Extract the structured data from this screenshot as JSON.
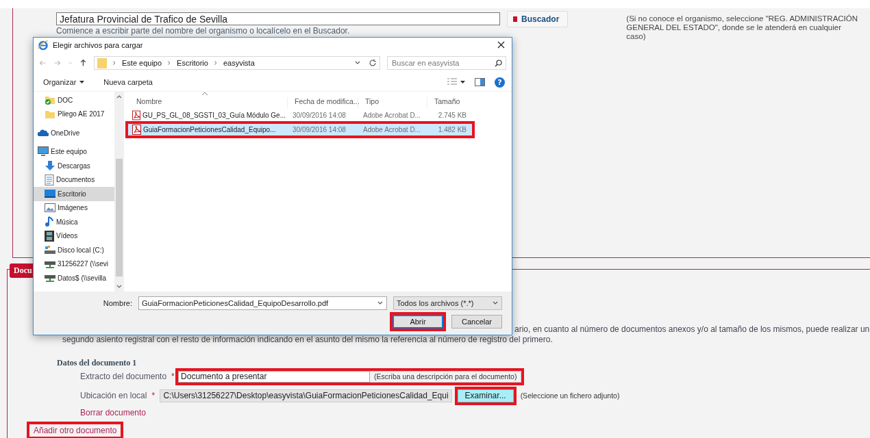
{
  "organism": {
    "value": "Jefatura Provincial de Trafico de Sevilla",
    "hint": "Comience a escribir parte del nombre del organismo o localícelo en el Buscador.",
    "button": "Buscador",
    "note": "(Si no conoce el organismo, seleccione \"REG. ADMINISTRACIÓN GENERAL DEL ESTADO\", donde se le atenderá en cualquier caso)"
  },
  "documents": {
    "legend": "Docu",
    "notice_line_1": "ario, en cuanto al número de documentos anexos y/o al tamaño de los mismos, puede realizar un",
    "notice_line_2": "segundo asiento registral con el resto de información indicando en el asunto del mismo la referencia al número de registro del primero.",
    "title": "Datos del documento 1",
    "fields": [
      {
        "kind": "text",
        "label": "Extracto del documento",
        "required_mark": "*",
        "value": "Documento a presentar",
        "hint": "(Escriba una descripción para el documento)",
        "highlighted": true
      },
      {
        "kind": "file",
        "label": "Ubicación en local",
        "required_mark": "*",
        "value": "C:\\Users\\31256227\\Desktop\\easyvista\\GuiaFormacionPeticionesCalidad_Equi",
        "button": {
          "label": "Examinar...",
          "highlighted": true
        },
        "note": "(Seleccione un fichero adjunto)"
      }
    ],
    "delete_link": "Borrar documento",
    "add_link": {
      "label": "Añadir otro documento",
      "highlighted": true
    }
  },
  "dialog": {
    "title": "Elegir archivos para cargar",
    "breadcrumbs": [
      "Este equipo",
      "Escritorio",
      "easyvista"
    ],
    "search_placeholder": "Buscar en easyvista",
    "organize": "Organizar",
    "new_folder": "Nueva carpeta",
    "help_glyph": "?",
    "quick_access": [
      {
        "label": "DOC",
        "kind": "synced-folder",
        "selected": false
      },
      {
        "label": "Pliego AE 2017",
        "kind": "folder",
        "selected": false
      }
    ],
    "tree": [
      {
        "label": "OneDrive",
        "kind": "cloud",
        "selected": false
      },
      {
        "label": "Este equipo",
        "kind": "computer",
        "selected": false,
        "children": [
          {
            "label": "Descargas",
            "kind": "download",
            "selected": false
          },
          {
            "label": "Documentos",
            "kind": "document",
            "selected": false
          },
          {
            "label": "Escritorio",
            "kind": "desktop",
            "selected": true
          },
          {
            "label": "Imágenes",
            "kind": "image",
            "selected": false
          },
          {
            "label": "Música",
            "kind": "music",
            "selected": false
          },
          {
            "label": "Vídeos",
            "kind": "video",
            "selected": false
          },
          {
            "label": "Disco local (C:)",
            "kind": "drive",
            "selected": false
          },
          {
            "label": "31256227 (\\\\sevi",
            "kind": "network",
            "selected": false
          },
          {
            "label": "Datos$ (\\\\sevilla",
            "kind": "network",
            "selected": false
          }
        ]
      }
    ],
    "columns": [
      "Nombre",
      "Fecha de modifica...",
      "Tipo",
      "Tamaño"
    ],
    "files": [
      {
        "name": "GU_PS_GL_08_SGSTI_03_Guía Módulo Ge...",
        "date": "30/09/2016 14:08",
        "type": "Adobe Acrobat D...",
        "size": "2.745 KB",
        "selected": false,
        "highlighted": false
      },
      {
        "name": "GuiaFormacionPeticionesCalidad_Equipo...",
        "date": "30/09/2016 14:08",
        "type": "Adobe Acrobat D...",
        "size": "1.482 KB",
        "selected": true,
        "highlighted": true
      }
    ],
    "file_name_label": "Nombre:",
    "file_name": "GuiaFormacionPeticionesCalidad_EquipoDesarrollo.pdf",
    "filter": "Todos los archivos (*.*)",
    "buttons": [
      {
        "label": "Abrir",
        "default": true,
        "highlighted": true
      },
      {
        "label": "Cancelar",
        "default": false,
        "highlighted": false
      }
    ]
  }
}
